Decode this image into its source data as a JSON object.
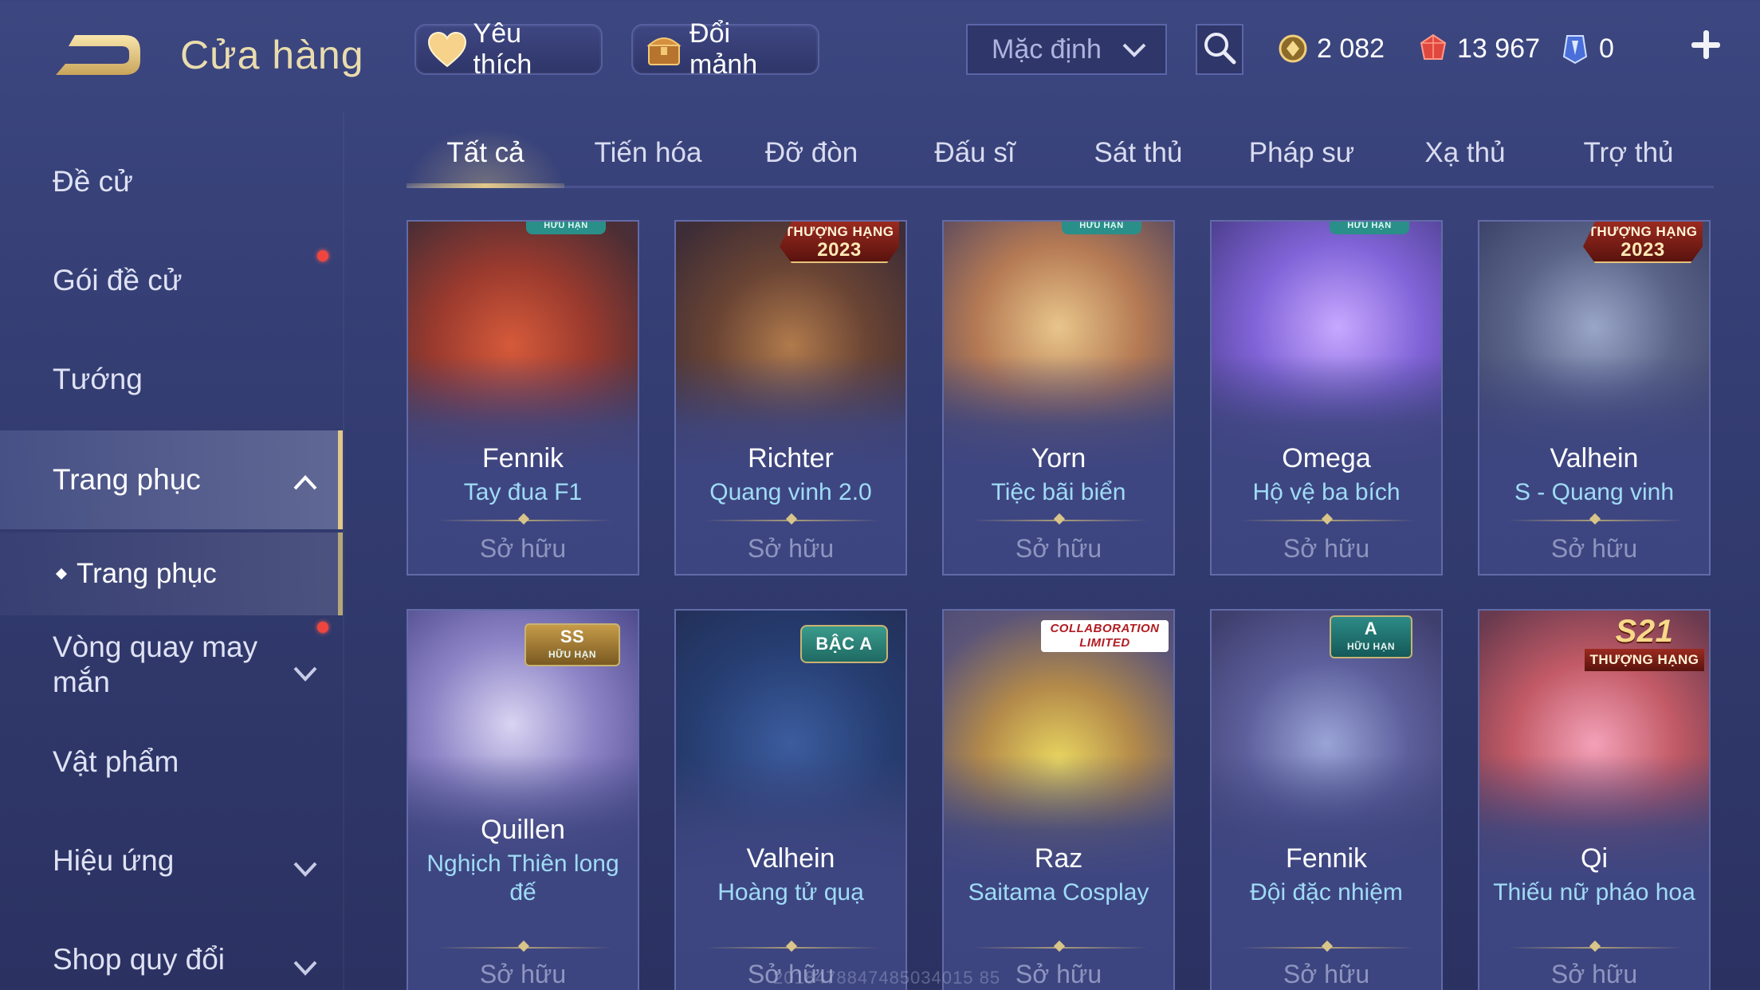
{
  "header": {
    "title": "Cửa hàng",
    "favorite_label": "Yêu thích",
    "shard_label": "Đổi mảnh",
    "sort_value": "Mặc định",
    "currencies": {
      "gold": "2 082",
      "ruby": "13 967",
      "gem": "0"
    }
  },
  "sidebar": {
    "items": [
      {
        "label": "Đề cử"
      },
      {
        "label": "Gói đề cử"
      },
      {
        "label": "Tướng"
      },
      {
        "label": "Trang phục"
      },
      {
        "label": "Vòng quay may mắn"
      },
      {
        "label": "Vật phẩm"
      },
      {
        "label": "Hiệu ứng"
      },
      {
        "label": "Shop quy đổi"
      }
    ],
    "sub_item": "Trang phục"
  },
  "tabs": [
    "Tất cả",
    "Tiến hóa",
    "Đỡ đòn",
    "Đấu sĩ",
    "Sát thủ",
    "Pháp sư",
    "Xạ thủ",
    "Trợ thủ"
  ],
  "active_tab": "Tất cả",
  "cards": [
    {
      "hero": "Fennik",
      "skin": "Tay đua F1",
      "status": "Sở hữu",
      "badge": "HỮU HẠN"
    },
    {
      "hero": "Richter",
      "skin": "Quang vinh 2.0",
      "status": "Sở hữu",
      "badge": "THƯỢNG HẠNG",
      "badge_year": "2023"
    },
    {
      "hero": "Yorn",
      "skin": "Tiệc bãi biển",
      "status": "Sở hữu",
      "badge": "HỮU HẠN"
    },
    {
      "hero": "Omega",
      "skin": "Hộ vệ ba bích",
      "status": "Sở hữu",
      "badge": "HỮU HẠN"
    },
    {
      "hero": "Valhein",
      "skin": "S - Quang vinh",
      "status": "Sở hữu",
      "badge": "THƯỢNG HẠNG",
      "badge_year": "2023"
    },
    {
      "hero": "Quillen",
      "skin": "Nghịch Thiên long đế",
      "status": "Sở hữu",
      "badge": "SS",
      "badge_sub": "HỮU HẠN"
    },
    {
      "hero": "Valhein",
      "skin": "Hoàng tử quạ",
      "status": "Sở hữu",
      "badge": "BẬC A"
    },
    {
      "hero": "Raz",
      "skin": "Saitama Cosplay",
      "status": "Sở hữu",
      "badge": "COLLABORATION",
      "badge_sub": "LIMITED"
    },
    {
      "hero": "Fennik",
      "skin": "Đội đặc nhiệm",
      "status": "Sở hữu",
      "badge": "A",
      "badge_sub": "HỮU HẠN"
    },
    {
      "hero": "Qi",
      "skin": "Thiếu nữ pháo hoa",
      "status": "Sở hữu",
      "badge": "THƯỢNG HẠNG",
      "badge_season": "S21"
    }
  ],
  "watermark": "2018478847485034015 85",
  "colors": {
    "accent_gold": "#e2c98b",
    "skin_name": "#9fdcf5",
    "notification": "#f0453f",
    "background": "#363f75"
  }
}
